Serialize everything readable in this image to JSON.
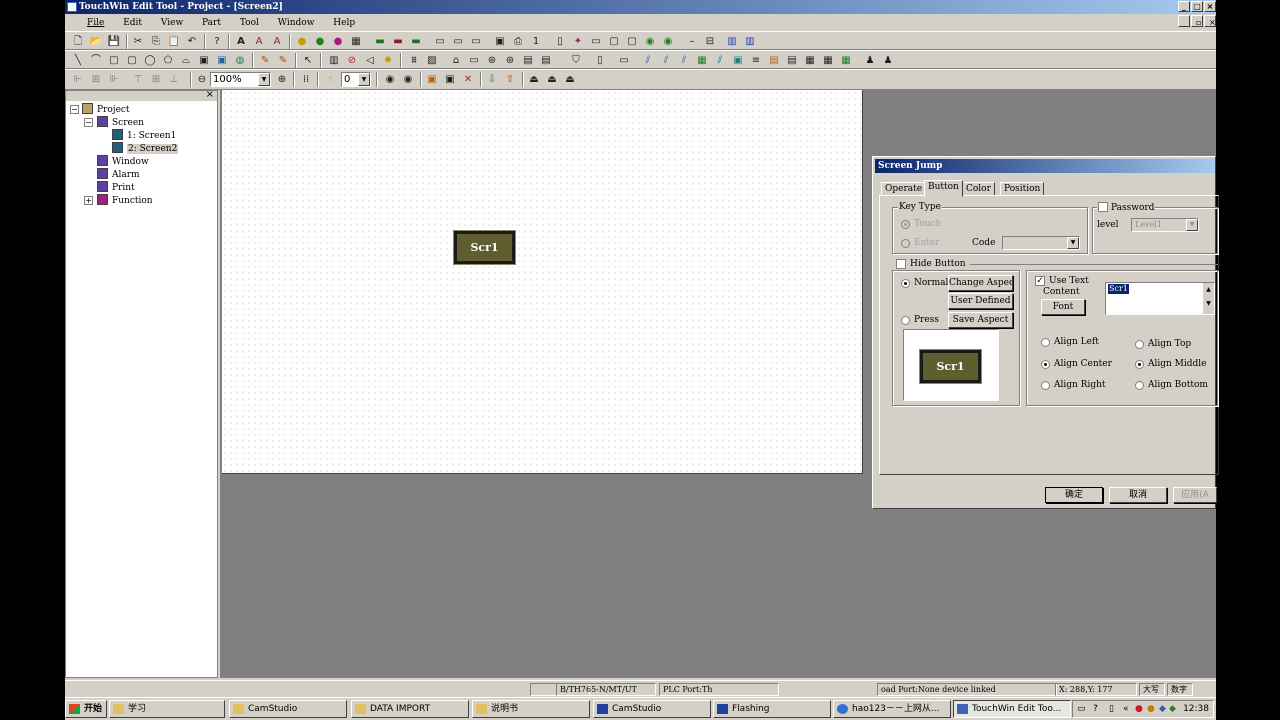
{
  "app": {
    "title": "TouchWin Edit Tool - Project - [Screen2]",
    "menu": [
      "File",
      "Edit",
      "View",
      "Part",
      "Tool",
      "Window",
      "Help"
    ],
    "zoom": "100%",
    "grid_value": "0"
  },
  "tree": {
    "root": "Project",
    "screen": "Screen",
    "screen1": "1: Screen1",
    "screen2": "2: Screen2",
    "window": "Window",
    "alarm": "Alarm",
    "print": "Print",
    "function": "Function"
  },
  "canvas": {
    "button_label": "Scr1"
  },
  "status": {
    "model": "B/TH765-N/MT/UT",
    "plc_port": "PLC Port:Th",
    "download_port": "oad Port:None device linked",
    "coords": "X: 288,Y: 177",
    "caps": "大写",
    "num": "数字"
  },
  "taskbar": {
    "start": "开始",
    "items": [
      "学习",
      "CamStudio",
      "DATA IMPORT",
      "说明书",
      "CamStudio",
      "Flashing",
      "hao123－－上网从...",
      "TouchWin Edit Too..."
    ],
    "clock": "12:38"
  },
  "dialog": {
    "title": "Screen Jump",
    "tabs": [
      "Operate",
      "Button",
      "Color",
      "Position"
    ],
    "key_type": "Key Type",
    "touch": "Touch",
    "enter": "Enter",
    "code": "Code",
    "password": "Password",
    "level": "level",
    "level_value": "Level1",
    "hide_button": "Hide Button",
    "normal": "Normal",
    "press": "Press",
    "change_aspect": "Change Aspect",
    "user_defined": "User Defined",
    "save_aspect": "Save Aspect",
    "use_text": "Use Text",
    "content": "Content",
    "content_value": "Scr1",
    "font": "Font",
    "align_left": "Align Left",
    "align_center": "Align Center",
    "align_right": "Align Right",
    "align_top": "Align Top",
    "align_middle": "Align Middle",
    "align_bottom": "Align Bottom",
    "preview_label": "Scr1",
    "ok": "确定",
    "cancel": "取消",
    "apply": "应用(A"
  }
}
